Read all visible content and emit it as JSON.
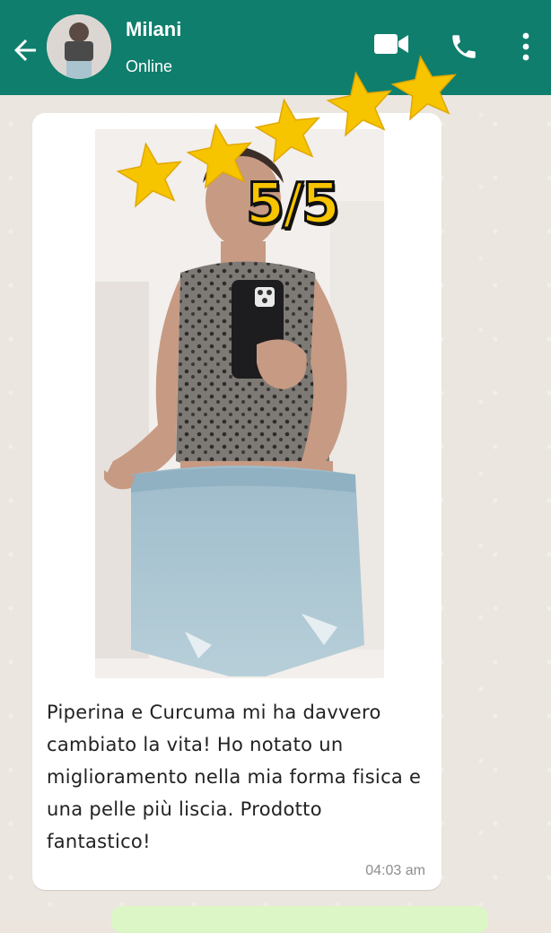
{
  "header": {
    "contact_name": "Milani",
    "status": "Online",
    "icons": [
      "back-arrow-icon",
      "video-call-icon",
      "phone-icon",
      "more-options-icon"
    ],
    "bar_color": "#0f7e6d"
  },
  "rating": {
    "label": "5/5",
    "stars": 5,
    "max_stars": 5,
    "star_color": "#f7c400"
  },
  "message": {
    "text": "Piperina e Curcuma mi ha davvero cambiato la vita! Ho notato un miglioramento nella mia forma fisica e una pelle più liscia. Prodotto fantastico!",
    "time": "04:03 am"
  }
}
